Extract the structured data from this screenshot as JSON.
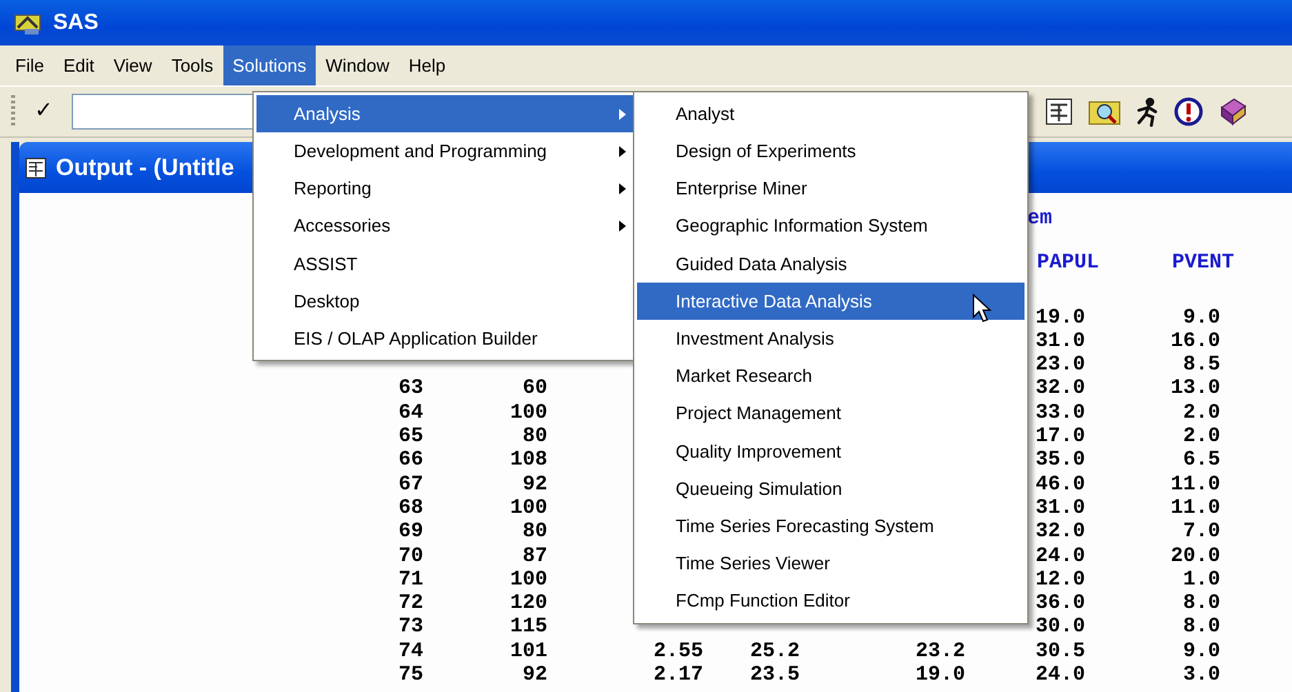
{
  "window": {
    "title": "SAS"
  },
  "menubar": [
    {
      "label": "File",
      "selected": false
    },
    {
      "label": "Edit",
      "selected": false
    },
    {
      "label": "View",
      "selected": false
    },
    {
      "label": "Tools",
      "selected": false
    },
    {
      "label": "Solutions",
      "selected": true
    },
    {
      "label": "Window",
      "selected": false
    },
    {
      "label": "Help",
      "selected": false
    }
  ],
  "toolbar": {
    "check": "✓"
  },
  "output_window": {
    "title": "Output - (Untitle",
    "subtitle": "em",
    "column_headers": [
      {
        "label": "PAPUL"
      },
      {
        "label": "PVENT"
      }
    ],
    "rows": [
      {
        "papul": "19.0",
        "pvent": "9.0"
      },
      {
        "papul": "31.0",
        "pvent": "16.0"
      },
      {
        "papul": "23.0",
        "pvent": "8.5"
      },
      {
        "column_1": "63",
        "column_2": "60",
        "papul": "32.0",
        "pvent": "13.0"
      },
      {
        "column_1": "64",
        "column_2": "100",
        "papul": "33.0",
        "pvent": "2.0"
      },
      {
        "column_1": "65",
        "column_2": "80",
        "papul": "17.0",
        "pvent": "2.0"
      },
      {
        "column_1": "66",
        "column_2": "108",
        "papul": "35.0",
        "pvent": "6.5"
      },
      {
        "column_1": "67",
        "column_2": "92",
        "papul": "46.0",
        "pvent": "11.0"
      },
      {
        "column_1": "68",
        "column_2": "100",
        "papul": "31.0",
        "pvent": "11.0"
      },
      {
        "column_1": "69",
        "column_2": "80",
        "papul": "32.0",
        "pvent": "7.0"
      },
      {
        "column_1": "70",
        "column_2": "87",
        "papul": "24.0",
        "pvent": "20.0"
      },
      {
        "column_1": "71",
        "column_2": "100",
        "papul": "12.0",
        "pvent": "1.0"
      },
      {
        "column_1": "72",
        "column_2": "120",
        "papul": "36.0",
        "pvent": "8.0"
      },
      {
        "column_1": "73",
        "column_2": "115",
        "papul": "30.0",
        "pvent": "8.0"
      },
      {
        "column_1": "74",
        "column_2": "101",
        "column_3": "2.55",
        "column_4": "25.2",
        "column_5": "23.2",
        "papul": "30.5",
        "pvent": "9.0"
      },
      {
        "column_1": "75",
        "column_2": "92",
        "column_3": "2.17",
        "column_4": "23.5",
        "column_5": "19.0",
        "papul": "24.0",
        "pvent": "3.0"
      }
    ]
  },
  "solutions_menu": {
    "items": [
      {
        "label": "Analysis",
        "selected": true,
        "has_submenu": true
      },
      {
        "label": "Development and Programming",
        "selected": false,
        "has_submenu": true
      },
      {
        "label": "Reporting",
        "selected": false,
        "has_submenu": true
      },
      {
        "label": "Accessories",
        "selected": false,
        "has_submenu": true
      },
      {
        "label": "ASSIST",
        "selected": false,
        "has_submenu": false
      },
      {
        "label": "Desktop",
        "selected": false,
        "has_submenu": false
      },
      {
        "label": "EIS / OLAP Application Builder",
        "selected": false,
        "has_submenu": false
      }
    ]
  },
  "analysis_menu": {
    "items": [
      {
        "label": "Analyst",
        "selected": false
      },
      {
        "label": "Design of Experiments",
        "selected": false
      },
      {
        "label": "Enterprise Miner",
        "selected": false
      },
      {
        "label": "Geographic Information System",
        "selected": false
      },
      {
        "label": "Guided Data Analysis",
        "selected": false
      },
      {
        "label": "Interactive Data Analysis",
        "selected": true
      },
      {
        "label": "Investment Analysis",
        "selected": false
      },
      {
        "label": "Market Research",
        "selected": false
      },
      {
        "label": "Project Management",
        "selected": false
      },
      {
        "label": "Quality Improvement",
        "selected": false
      },
      {
        "label": "Queueing Simulation",
        "selected": false
      },
      {
        "label": "Time Series Forecasting System",
        "selected": false
      },
      {
        "label": "Time Series Viewer",
        "selected": false
      },
      {
        "label": "FCmp Function Editor",
        "selected": false
      }
    ]
  }
}
